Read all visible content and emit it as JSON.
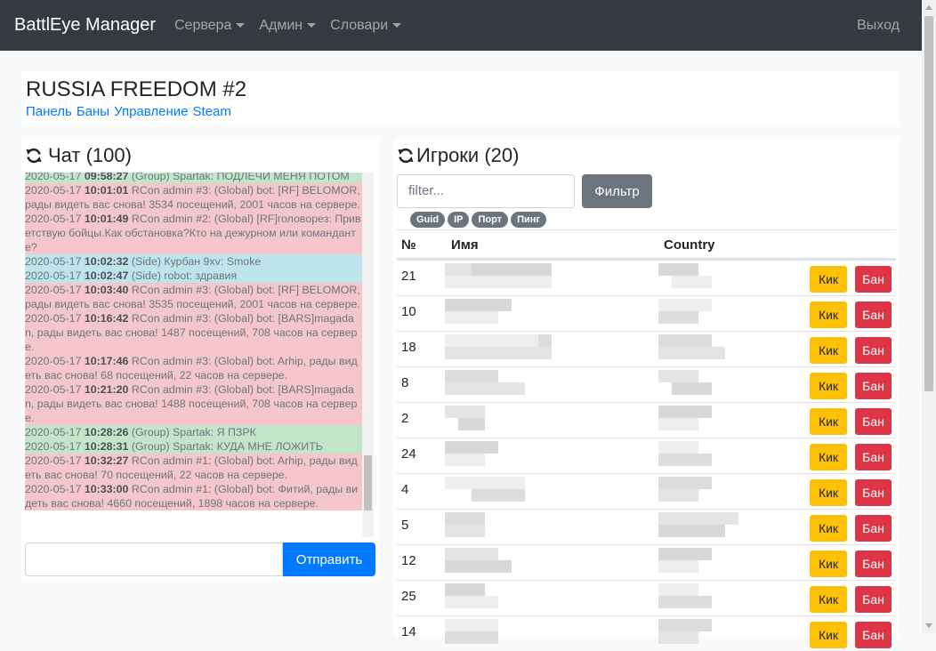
{
  "navbar": {
    "brand": "BattlEye Manager",
    "menus": [
      "Сервера",
      "Админ",
      "Словари"
    ],
    "logout": "Выход"
  },
  "server": {
    "title": "RUSSIA FREEDOM #2",
    "links": [
      "Панель",
      "Баны",
      "Управление",
      "Steam"
    ]
  },
  "chat": {
    "title": "Чат (100)",
    "send_label": "Отправить",
    "input_value": "",
    "messages": [
      {
        "date": "2020-05-17",
        "time": "09:58:27",
        "text": "(Group) Spartak: ПОДЛЕЧИ МЕНЯ ПОТОМ",
        "color": "green"
      },
      {
        "date": "2020-05-17",
        "time": "10:01:01",
        "text": "RCon admin #3: (Global) bot: [RF] BELOMOR, рады видеть вас снова! 3534 посещений, 2001 часов на сервере.",
        "color": "red"
      },
      {
        "date": "2020-05-17",
        "time": "10:01:49",
        "text": "RCon admin #2: (Global) [RF]головорез: Приветствую бойцы.Как обстановка?Кто на дежурном или командантe?",
        "color": "red"
      },
      {
        "date": "2020-05-17",
        "time": "10:02:32",
        "text": "(Side) Курбан 9xv: Smoke",
        "color": "blue"
      },
      {
        "date": "2020-05-17",
        "time": "10:02:47",
        "text": "(Side) robot: здравия",
        "color": "blue"
      },
      {
        "date": "2020-05-17",
        "time": "10:03:40",
        "text": "RCon admin #3: (Global) bot: [RF] BELOMOR, рады видеть вас снова! 3535 посещений, 2001 часов на сервере.",
        "color": "red"
      },
      {
        "date": "2020-05-17",
        "time": "10:16:42",
        "text": "RCon admin #3: (Global) bot: [BARS]magadan, рады видеть вас снова! 1487 посещений, 708 часов на сервере.",
        "color": "red"
      },
      {
        "date": "2020-05-17",
        "time": "10:17:46",
        "text": "RCon admin #3: (Global) bot: Arhip, рады видеть вас снова! 68 посещений, 22 часов на сервере.",
        "color": "red"
      },
      {
        "date": "2020-05-17",
        "time": "10:21:20",
        "text": "RCon admin #3: (Global) bot: [BARS]magadan, рады видеть вас снова! 1488 посещений, 708 часов на сервере.",
        "color": "red"
      },
      {
        "date": "2020-05-17",
        "time": "10:28:26",
        "text": "(Group) Spartak: Я ПЗРК",
        "color": "green"
      },
      {
        "date": "2020-05-17",
        "time": "10:28:31",
        "text": "(Group) Spartak: КУДА МНЕ ЛОЖИТЬ",
        "color": "green"
      },
      {
        "date": "2020-05-17",
        "time": "10:32:27",
        "text": "RCon admin #1: (Global) bot: Arhip, рады видеть вас снова! 70 посещений, 22 часов на сервере.",
        "color": "red"
      },
      {
        "date": "2020-05-17",
        "time": "10:33:00",
        "text": "RCon admin #1: (Global) bot: Фитий, рады видеть вас снова! 4660 посещений, 1898 часов на сервере.",
        "color": "red"
      }
    ]
  },
  "players": {
    "title": "Игроки (20)",
    "filter_placeholder": "filter...",
    "filter_button": "Фильтр",
    "badges": [
      "Guid",
      "IP",
      "Порт",
      "Пинг"
    ],
    "columns": [
      "№",
      "Имя",
      "Country"
    ],
    "kick_label": "Кик",
    "ban_label": "Бан",
    "rows": [
      "21",
      "10",
      "18",
      "8",
      "2",
      "24",
      "4",
      "5",
      "12",
      "25",
      "14"
    ]
  },
  "colors": {
    "navbar": "#343a40",
    "primary": "#007bff",
    "warning": "#ffc107",
    "danger": "#dc3545",
    "secondary": "#6c757d",
    "chat_red": "#f5c6cb",
    "chat_green": "#c3e6cb",
    "chat_blue": "#bee5eb"
  }
}
